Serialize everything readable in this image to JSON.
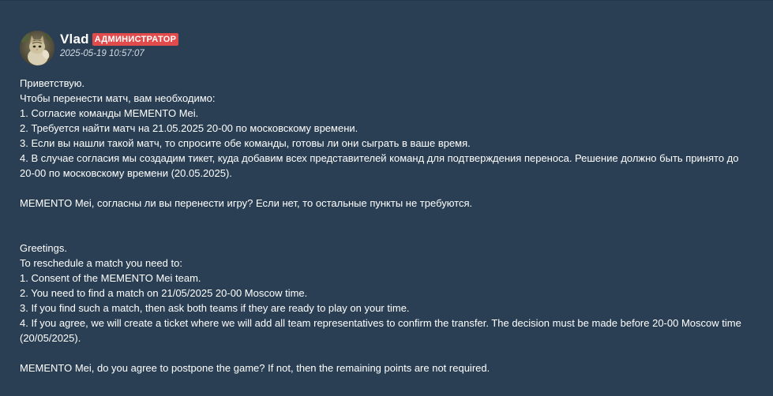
{
  "post": {
    "author": {
      "name": "Vlad",
      "role_badge": "АДМИНИСТРАТОР",
      "timestamp": "2025-05-19 10:57:07",
      "avatar": "cat-photo-avatar"
    },
    "colors": {
      "background": "#2a3f53",
      "badge": "#e24b4b",
      "text": "#ffffff"
    },
    "body": {
      "ru": {
        "greeting": "Приветствую.",
        "intro": "Чтобы перенести матч, вам необходимо:",
        "item1": "1. Согласие команды MEMENTO Mei.",
        "item2": "2. Требуется найти матч на 21.05.2025 20-00 по московскому времени.",
        "item3": "3. Если вы нашли такой матч, то спросите обе команды, готовы ли они сыграть в ваше время.",
        "item4": "4. В случае согласия мы создадим тикет, куда добавим всех представителей команд для подтверждения переноса. Решение должно быть принято до 20-00 по московскому времени (20.05.2025).",
        "question": "MEMENTO Mei, согласны ли вы перенести игру? Если нет, то остальные пункты не требуются."
      },
      "en": {
        "greeting": "Greetings.",
        "intro": "To reschedule a match you need to:",
        "item1": "1. Consent of the MEMENTO Mei team.",
        "item2": "2. You need to find a match on 21/05/2025 20-00 Moscow time.",
        "item3": "3. If you find such a match, then ask both teams if they are ready to play on your time.",
        "item4": "4. If you agree, we will create a ticket where we will add all team representatives to confirm the transfer. The decision must be made before 20-00 Moscow time (20/05/2025).",
        "question": "MEMENTO Mei, do you agree to postpone the game? If not, then the remaining points are not required."
      }
    }
  }
}
